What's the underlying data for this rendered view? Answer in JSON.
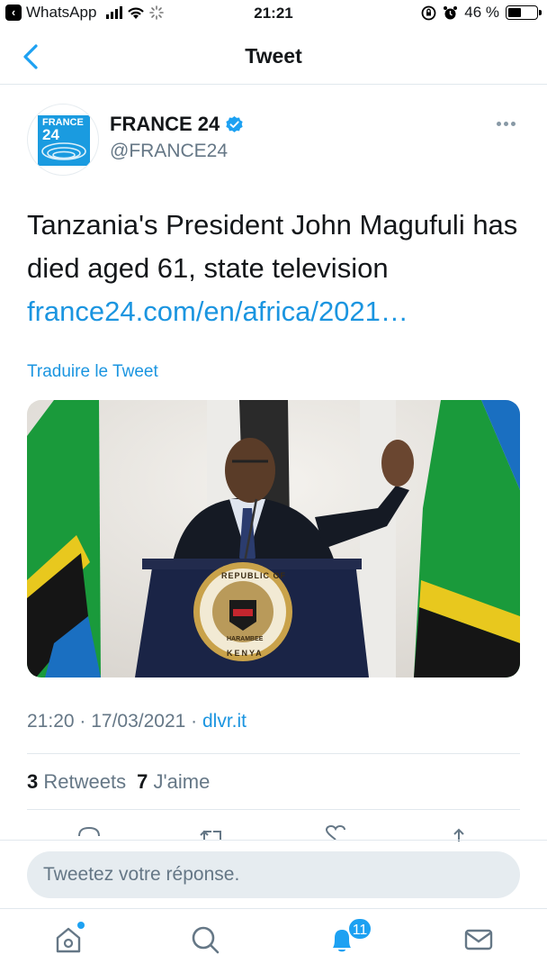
{
  "status_bar": {
    "back_app": "WhatsApp",
    "time": "21:21",
    "battery": "46 %",
    "battery_level": 0.46
  },
  "nav": {
    "title": "Tweet"
  },
  "tweet": {
    "author_name": "FRANCE 24",
    "handle": "@FRANCE24",
    "logo_text_line1": "FRANCE",
    "logo_text_line2": "24",
    "text": "Tanzania's President John Magufuli has died aged 61, state television",
    "link": "france24.com/en/africa/2021…",
    "translate": "Traduire le Tweet",
    "timestamp": "21:20 · 17/03/2021 · ",
    "source": "dlvr.it",
    "retweets_count": "3",
    "retweets_label": "Retweets",
    "likes_count": "7",
    "likes_label": "J'aime",
    "image_caption": {
      "seal_top": "REPUBLIC OF",
      "seal_bottom": "KENYA",
      "seal_ribbon": "HARAMBEE"
    }
  },
  "reply": {
    "placeholder": "Tweetez votre réponse."
  },
  "tabbar": {
    "notifications_badge": "11"
  },
  "colors": {
    "accent": "#1b95e0",
    "brand": "#1da1f2"
  }
}
